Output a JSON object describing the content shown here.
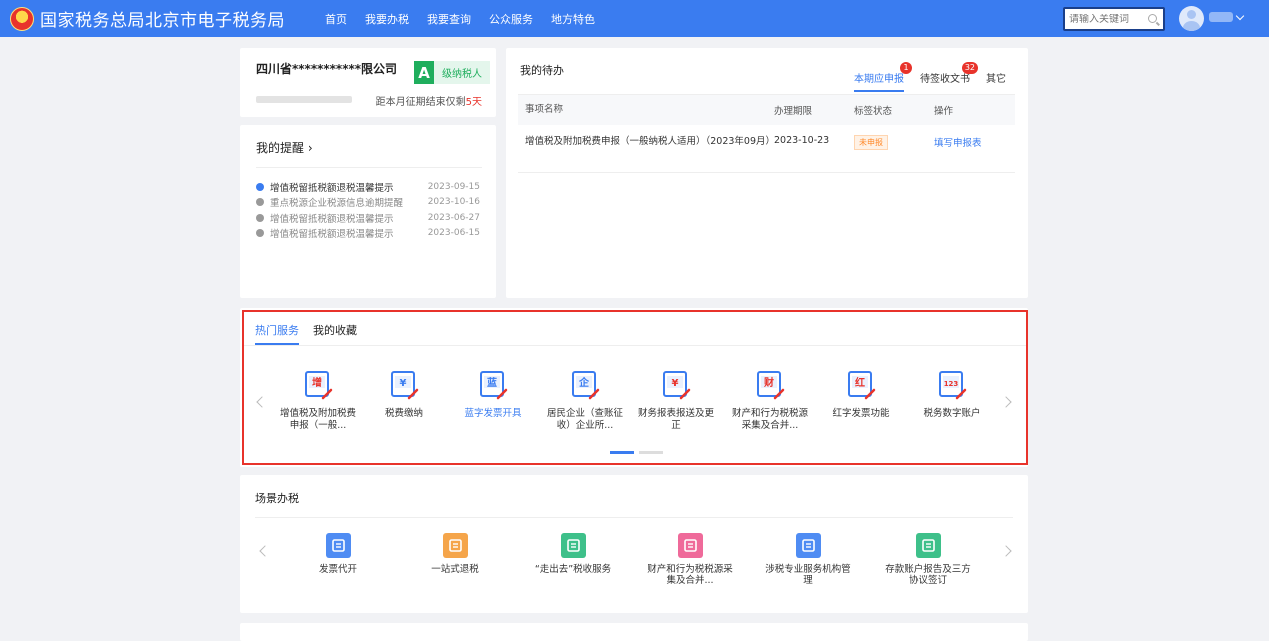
{
  "header": {
    "site_title": "国家税务总局北京市电子税务局",
    "nav": [
      "首页",
      "我要办税",
      "我要查询",
      "公众服务",
      "地方特色"
    ],
    "search_placeholder": "请输入关键词"
  },
  "company": {
    "name": "四川省***********限公司",
    "grade_letter": "A",
    "grade_text": "级纳税人",
    "deadline_prefix": "距本月征期结束仅剩",
    "deadline_days": "5天"
  },
  "reminders": {
    "title": "我的提醒 ›",
    "items": [
      {
        "text": "增值税留抵税额退税温馨提示",
        "date": "2023-09-15"
      },
      {
        "text": "重点税源企业税源信息逾期提醒",
        "date": "2023-10-16"
      },
      {
        "text": "增值税留抵税额退税温馨提示",
        "date": "2023-06-27"
      },
      {
        "text": "增值税留抵税额退税温馨提示",
        "date": "2023-06-15"
      }
    ]
  },
  "todo": {
    "title": "我的待办",
    "tabs": [
      {
        "label": "本期应申报",
        "badge": "1"
      },
      {
        "label": "待签收文书",
        "badge": "32"
      },
      {
        "label": "其它",
        "badge": ""
      }
    ],
    "columns": [
      "事项名称",
      "办理期限",
      "标签状态",
      "操作"
    ],
    "rows": [
      {
        "name": "增值税及附加税费申报（一般纳税人适用）（2023年09月）",
        "deadline": "2023-10-23",
        "status": "未申报",
        "action": "填写申报表"
      }
    ]
  },
  "hot_services": {
    "tabs": [
      "热门服务",
      "我的收藏"
    ],
    "items": [
      {
        "label": "增值税及附加税费申报（一般...",
        "icon": "vat-declare-icon",
        "glyph": "增"
      },
      {
        "label": "税费缴纳",
        "icon": "tax-payment-icon",
        "glyph": "¥"
      },
      {
        "label": "蓝字发票开具",
        "icon": "blue-invoice-icon",
        "glyph": "蓝"
      },
      {
        "label": "居民企业（查账征收）企业所...",
        "icon": "enterprise-tax-icon",
        "glyph": "企"
      },
      {
        "label": "财务报表报送及更正",
        "icon": "financial-report-icon",
        "glyph": "¥"
      },
      {
        "label": "财产和行为税税源采集及合并...",
        "icon": "property-tax-icon",
        "glyph": "财"
      },
      {
        "label": "红字发票功能",
        "icon": "red-invoice-icon",
        "glyph": "红"
      },
      {
        "label": "税务数字账户",
        "icon": "digital-account-icon",
        "glyph": "123"
      }
    ]
  },
  "scene": {
    "title": "场景办税",
    "items": [
      {
        "label": "发票代开",
        "icon": "invoice-issue-icon",
        "color": "#4f8cf3"
      },
      {
        "label": "一站式退税",
        "icon": "tax-refund-icon",
        "color": "#f5a54a"
      },
      {
        "label": "“走出去”税收服务",
        "icon": "going-global-icon",
        "color": "#3ec08a"
      },
      {
        "label": "财产和行为税税源采集及合并...",
        "icon": "property-scene-icon",
        "color": "#ef6a9a"
      },
      {
        "label": "涉税专业服务机构管理",
        "icon": "agency-icon",
        "color": "#4f8cf3"
      },
      {
        "label": "存款账户报告及三方协议签订",
        "icon": "deposit-account-icon",
        "color": "#3ec08a"
      }
    ]
  },
  "colors": {
    "primary": "#3a7cf0",
    "danger": "#e8332b",
    "success": "#1fae5d"
  }
}
